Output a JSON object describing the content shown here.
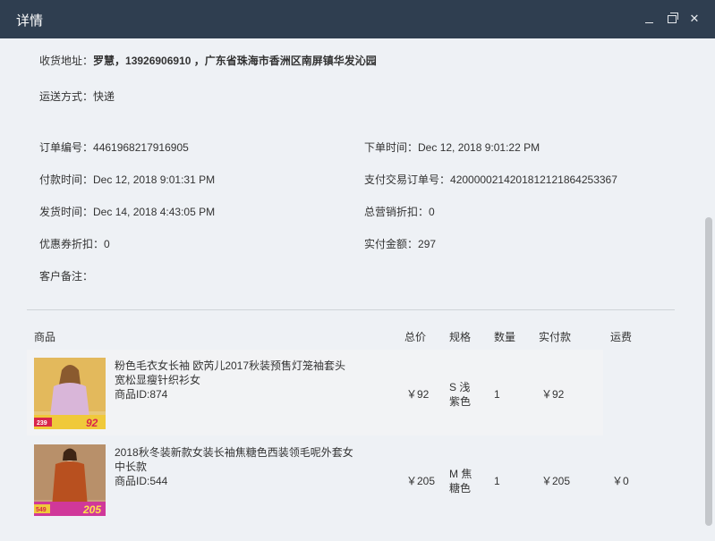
{
  "window": {
    "title": "详情"
  },
  "info": {
    "address_label": "收货地址：",
    "address_value": "罗慧，13926906910 ，广东省珠海市香洲区南屏镇华发沁园",
    "shipping_label": "运送方式：",
    "shipping_value": "快递",
    "order_no_label": "订单编号：",
    "order_no_value": "4461968217916905",
    "order_time_label": "下单时间：",
    "order_time_value": "Dec 12, 2018 9:01:22 PM",
    "pay_time_label": "付款时间：",
    "pay_time_value": "Dec 12, 2018 9:01:31 PM",
    "trade_no_label": "支付交易订单号：",
    "trade_no_value": "4200000214201812121864253367",
    "ship_time_label": "发货时间：",
    "ship_time_value": "Dec 14, 2018 4:43:05 PM",
    "marketing_label": "总营销折扣：",
    "marketing_value": "0",
    "coupon_label": "优惠券折扣：",
    "coupon_value": "0",
    "paid_label": "实付金额：",
    "paid_value": "297",
    "note_label": "客户备注：",
    "note_value": ""
  },
  "table": {
    "headers": {
      "product": "商品",
      "total": "总价",
      "spec": "规格",
      "qty": "数量",
      "paid": "实付款",
      "shipping": "运费"
    },
    "items": [
      {
        "name": "粉色毛衣女长袖 欧芮儿2017秋装预售灯笼袖套头宽松显瘦针织衫女",
        "product_id": "商品ID:874",
        "total": "￥92",
        "spec": "S 浅紫色",
        "qty": "1",
        "paid": "￥92",
        "shipping": "",
        "thumb_price": "92",
        "thumb_old": "239"
      },
      {
        "name": "2018秋冬装新款女装长袖焦糖色西装领毛呢外套女中长款",
        "product_id": "商品ID:544",
        "total": "￥205",
        "spec": "M 焦糖色",
        "qty": "1",
        "paid": "￥205",
        "shipping": "￥0",
        "thumb_price": "205",
        "thumb_old": "549"
      }
    ]
  }
}
